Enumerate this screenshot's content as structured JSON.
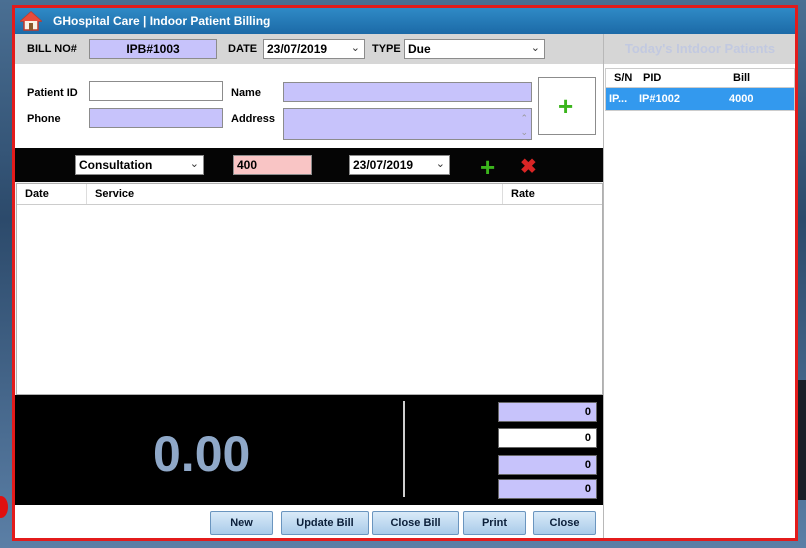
{
  "window": {
    "title": "GHospital Care  | Indoor Patient Billing"
  },
  "bill": {
    "label": "BILL NO#",
    "value": "IPB#1003",
    "date_label": "DATE",
    "date": "23/07/2019",
    "type_label": "TYPE",
    "type": "Due"
  },
  "patient": {
    "id_label": "Patient ID",
    "id": "",
    "phone_label": "Phone",
    "phone": "",
    "name_label": "Name",
    "name": "",
    "address_label": "Address",
    "address": ""
  },
  "service": {
    "selected": "Consultation",
    "amount": "400",
    "date": "23/07/2019"
  },
  "grid": {
    "columns": [
      "Date",
      "Service",
      "Rate"
    ],
    "rows": []
  },
  "totals": {
    "grand": "0.00",
    "values": [
      "0",
      "0",
      "0",
      "0"
    ]
  },
  "buttons": {
    "new": "New",
    "update": "Update Bill",
    "close_bill": "Close Bill",
    "print": "Print",
    "close": "Close"
  },
  "side": {
    "title": "Today's Intdoor Patients",
    "columns": [
      "S/N",
      "PID",
      "Bill"
    ],
    "rows": [
      {
        "sn": "IP...",
        "pid": "IP#1002",
        "bill": "4000"
      }
    ]
  },
  "colors": {
    "accent": "#1c6aa7",
    "highlight": "#3399ee",
    "field": "#c7c3fb",
    "amount_field": "#f9c5c5"
  },
  "icons": {
    "home": "home-icon",
    "add": "plus-icon",
    "remove": "x-icon"
  }
}
